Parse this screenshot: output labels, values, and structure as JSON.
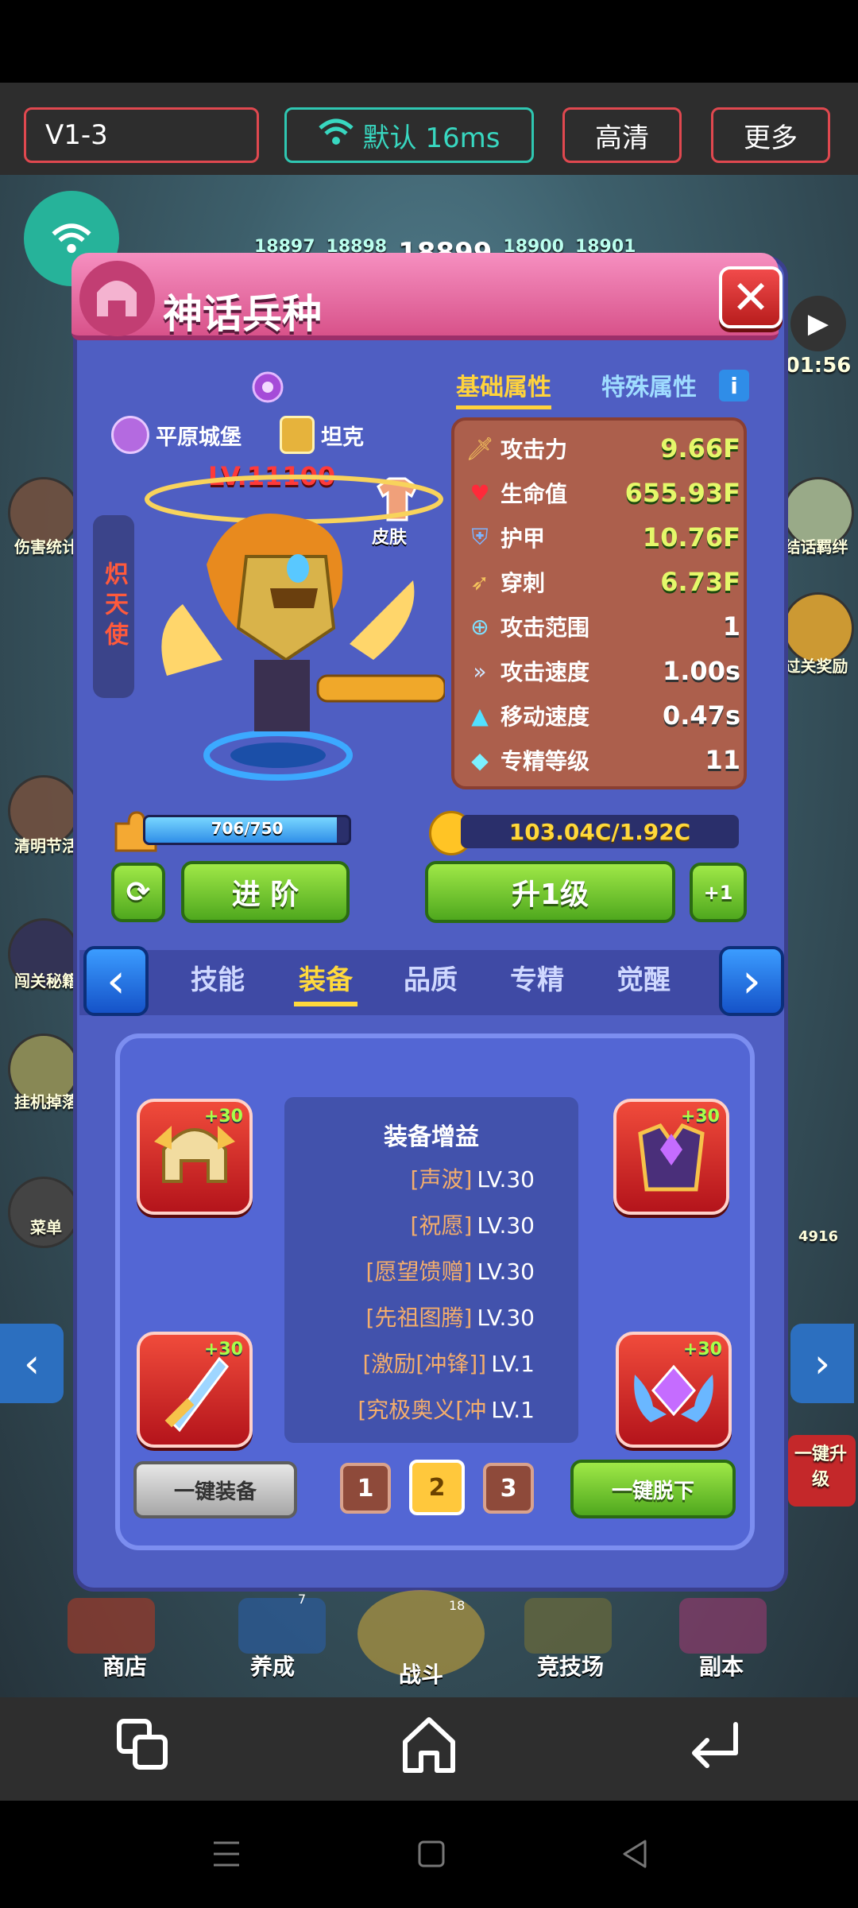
{
  "header": {
    "version": "V1-3",
    "network": "默认 16ms",
    "quality": "高清",
    "more": "更多"
  },
  "background": {
    "stage_numbers": [
      "18897",
      "18898",
      "18899",
      "18900",
      "18901"
    ],
    "left_labels": [
      "伤害统计",
      "清明节活",
      "闯关秘籍",
      "挂机掉落",
      "菜单"
    ],
    "right_labels": [
      "01:56",
      "结话羁绊",
      "过关奖励",
      "4916",
      "一键升级"
    ],
    "bottom_nav": [
      "商店",
      "养成",
      "战斗",
      "竞技场",
      "副本"
    ],
    "nav_badges": [
      "7",
      "18"
    ]
  },
  "panel": {
    "title": "神话兵种",
    "tab_basic": "基础属性",
    "tab_special": "特殊属性",
    "tag_castle": "平原城堡",
    "tag_role": "坦克",
    "hero_name": "炽天使",
    "level": "LV.11100",
    "skin": "皮肤"
  },
  "stats": [
    {
      "icon": "sword-icon",
      "label": "攻击力",
      "value": "9.66F",
      "color": "green"
    },
    {
      "icon": "heart-icon",
      "label": "生命值",
      "value": "655.93F",
      "color": "green"
    },
    {
      "icon": "shield-icon",
      "label": "护甲",
      "value": "10.76F",
      "color": "green"
    },
    {
      "icon": "pierce-icon",
      "label": "穿刺",
      "value": "6.73F",
      "color": "green"
    },
    {
      "icon": "range-icon",
      "label": "攻击范围",
      "value": "1",
      "color": "white"
    },
    {
      "icon": "attack-speed-icon",
      "label": "攻击速度",
      "value": "1.00s",
      "color": "white"
    },
    {
      "icon": "boot-icon",
      "label": "移动速度",
      "value": "0.47s",
      "color": "white"
    },
    {
      "icon": "mastery-icon",
      "label": "专精等级",
      "value": "11",
      "color": "white"
    }
  ],
  "progress": {
    "shards": "706/750",
    "shards_fraction": 0.94,
    "gold": "103.04C/1.92C"
  },
  "actions": {
    "advance": "进 阶",
    "upgrade": "升1级",
    "plus": "+1"
  },
  "tabs": [
    "技能",
    "装备",
    "品质",
    "专精",
    "觉醒"
  ],
  "active_tab": "装备",
  "equipment": {
    "bonus_title": "装备增益",
    "bonuses": [
      {
        "name": "[声波]",
        "level": "LV.30"
      },
      {
        "name": "[祝愿]",
        "level": "LV.30"
      },
      {
        "name": "[愿望馈赠]",
        "level": "LV.30"
      },
      {
        "name": "[先祖图腾]",
        "level": "LV.30"
      },
      {
        "name": "[激励[冲锋]]",
        "level": "LV.1"
      },
      {
        "name": "[究极奥义[冲",
        "level": "LV.1"
      }
    ],
    "slot_level": "+30",
    "equip_all": "一键装备",
    "unequip_all": "一键脱下",
    "pages": [
      "1",
      "2",
      "3"
    ],
    "selected_page": "2"
  }
}
